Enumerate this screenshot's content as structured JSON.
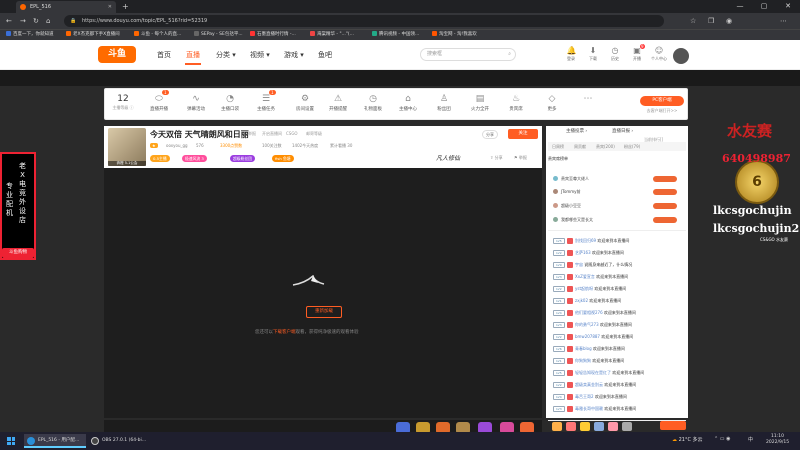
{
  "browser": {
    "tab_title": "EPL_516",
    "url": "https://www.douyu.com/topic/EPL_516?rid=52319",
    "bookmarks": [
      "百度一下，你就知道",
      "老X杰克都下手X直播间",
      "斗鱼 - 每个人的直...",
      "SEPay - SE包括平...",
      "石墨直播时行情 -...",
      "海棠精华 - \"...\"(...",
      "腾讯视频 - 中国领...",
      "淘宝网 - 淘!我喜欢"
    ]
  },
  "header": {
    "logo": "斗鱼",
    "nav": [
      "首页",
      "直播",
      "分类",
      "视频",
      "游戏",
      "鱼吧"
    ],
    "active_nav": "直播",
    "search_placeholder": "搜索框",
    "top_icons": [
      {
        "label": "登录",
        "icon": "bell-icon"
      },
      {
        "label": "下载",
        "icon": "download-icon",
        "badge": "新"
      },
      {
        "label": "历史",
        "icon": "history-icon"
      },
      {
        "label": "开播",
        "icon": "camera-icon"
      },
      {
        "label": "鱼吧",
        "icon": "chat-icon",
        "badge": "9"
      },
      {
        "label": "个人中心",
        "icon": "user-icon"
      }
    ]
  },
  "toolbar": {
    "level_number": "12",
    "level_label": "主播等级 ⓘ",
    "items": [
      {
        "label": "直播开播",
        "badge": "1"
      },
      {
        "label": "弹幕活动"
      },
      {
        "label": "主播口袋"
      },
      {
        "label": "主播任务",
        "badge": "1"
      },
      {
        "label": "房间设置"
      },
      {
        "label": "开播提醒"
      },
      {
        "label": "礼物面板"
      },
      {
        "label": "主播中心"
      },
      {
        "label": "粉丝团"
      },
      {
        "label": "火力全开"
      },
      {
        "label": "贵宾席"
      },
      {
        "label": "更多"
      }
    ],
    "pc_button": "PC客户端",
    "pc_sub": "去客户端打开>>"
  },
  "room": {
    "avatar_label": "奔橙 5-1公会",
    "title": "今天双倍 天气晴朗风和日丽",
    "meta": [
      "举报",
      "开启直播间",
      "CSGO",
      "邮寄等级"
    ],
    "streamer": "ooxyou_gg",
    "level": "576",
    "info": [
      "3300点赞数",
      "100关注数",
      "1402今天热度",
      "累计看播 30"
    ],
    "tags": [
      {
        "text": "0.5主播",
        "color": "#ffa41b"
      },
      {
        "text": "极速风流 3",
        "color": "#ff4e9c"
      },
      {
        "text": "超级粉丝团",
        "color": "#9b3de0"
      },
      {
        "text": "fish 鱼塘",
        "color": "#ff8d00"
      }
    ],
    "buttons": [
      "分享",
      "关注"
    ],
    "follow_label": "关注",
    "brand": "凡人修仙",
    "reload_label": "重新加载",
    "hint_prefix": "您还可以",
    "hint_link": "下载客户端",
    "hint_suffix": "观看，获得纯净极速的观看体验"
  },
  "chat": {
    "tabs": [
      "主播投票 ›",
      "直播日报 ›"
    ],
    "tab2_right": "当前排行[]",
    "sub_tabs": [
      "日周榜",
      "周贡献",
      "贵宾(200)",
      "粉丝(79)"
    ],
    "nobles_title": "贵宾席榜单",
    "nobles": [
      "贵宾至尊大佬人",
      "JTommy前",
      "超级小豆豆",
      "我都哪些又是长太"
    ],
    "messages": [
      {
        "lv": "LV5",
        "user": "别找回归69",
        "text": "欢迎来到本直播间"
      },
      {
        "lv": "LV2",
        "user": "艺萨163",
        "text": "欢迎来到本直播间"
      },
      {
        "lv": "LV9",
        "user": "宇宙 ",
        "text": "说随身来越近了，什么情况"
      },
      {
        "lv": "LV3",
        "user": "XxZ爱宣言",
        "text": "欢迎来到本直播间"
      },
      {
        "lv": "LV2",
        "user": "yst起航呀",
        "text": "欢迎来到本直播间"
      },
      {
        "lv": "LV1",
        "user": "zxjk02",
        "text": "欢迎来到本直播间"
      },
      {
        "lv": "LV4",
        "user": "他们要相视276",
        "text": "欢迎来到本直播间"
      },
      {
        "lv": "LV3",
        "user": "你的勇气273",
        "text": "欢迎来到本直播间"
      },
      {
        "lv": "LV2",
        "user": "bmw207887",
        "text": "欢迎来到本直播间"
      },
      {
        "lv": "LV6",
        "user": "青春blog",
        "text": "欢迎来到本直播间"
      },
      {
        "lv": "LV1",
        "user": "你狗狗狗",
        "text": "欢迎来到本直播间"
      },
      {
        "lv": "LV5",
        "user": "轻轻告知现在是红了",
        "text": "欢迎来到本直播间"
      },
      {
        "lv": "LV2",
        "user": "超级卖真金别云",
        "text": "欢迎来到本直播间"
      },
      {
        "lv": "LV4",
        "user": "毒舌王哥2",
        "text": "欢迎来到本直播间"
      },
      {
        "lv": "LV3",
        "user": "毒雅长哥中国赖",
        "text": "欢迎来到本直播间"
      }
    ]
  },
  "left_banner": {
    "col1": "老X电竞外设店",
    "col2": "专业配机",
    "button": "斗鱼购物"
  },
  "overlay": {
    "title": "水友赛",
    "phone": "640498987",
    "coin_number": "6",
    "line1": "lkcsgochujin",
    "line2": "lkcsgochujin2",
    "small": "CS&GO 水友赛"
  },
  "taskbar": {
    "item1": "EPL_516 - 用户配...",
    "item2": "OBS 27.0.1 (64-bi...",
    "weather": "21°C 多云",
    "ime": "中",
    "time": "11:10",
    "date": "2022/9/15"
  },
  "colors": {
    "accent": "#ff5d23",
    "brand": "#ff6b00"
  }
}
